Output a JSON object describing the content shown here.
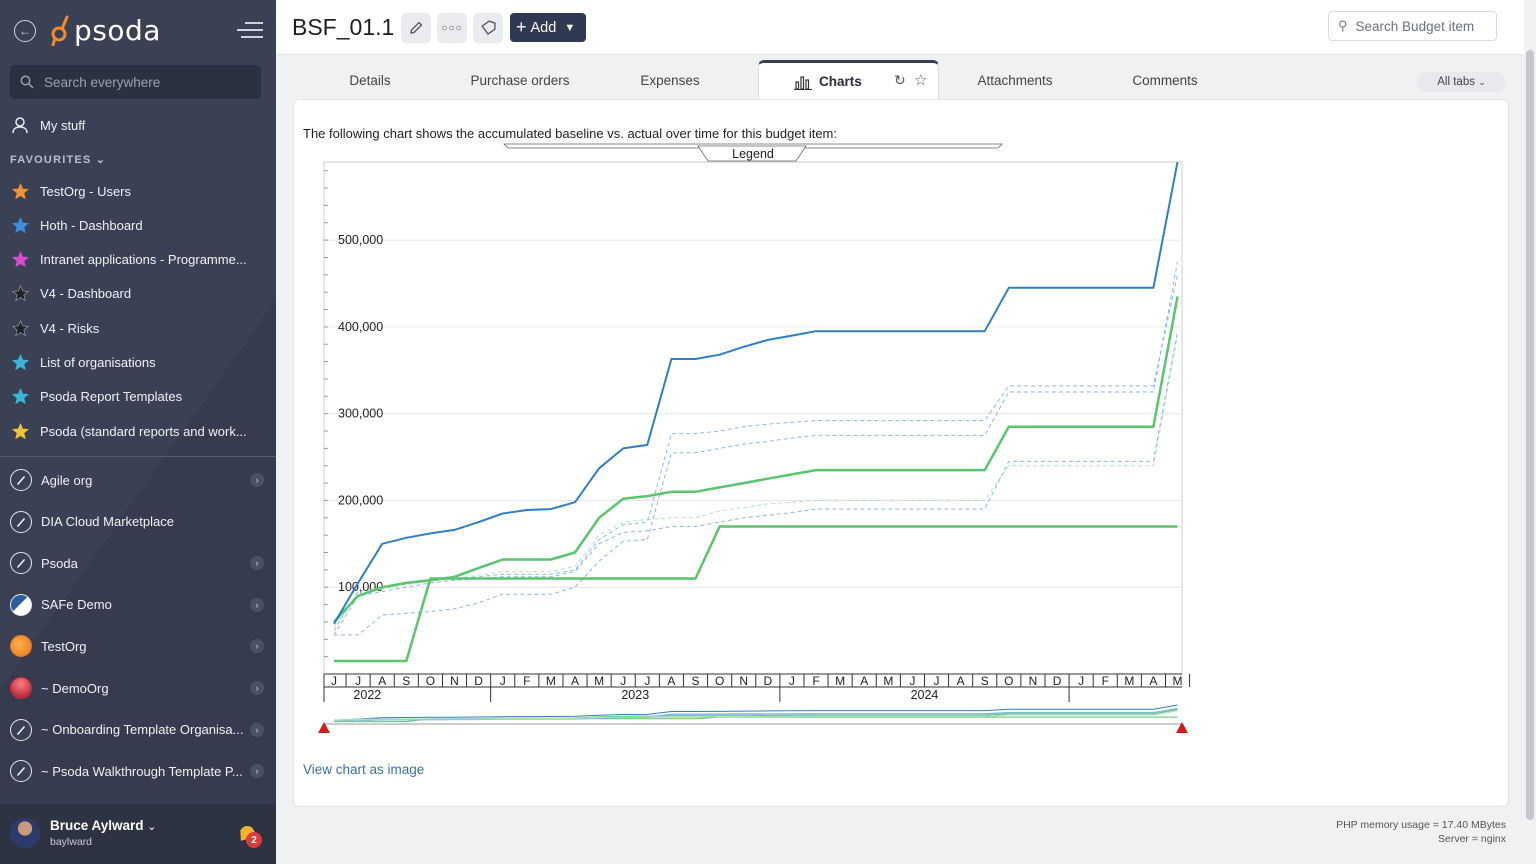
{
  "app": {
    "name": "psoda"
  },
  "sidebar": {
    "search_placeholder": "Search everywhere",
    "my_stuff": "My stuff",
    "favourites_label": "FAVOURITES",
    "favourites": [
      {
        "label": "TestOrg - Users",
        "color": "#f0913a"
      },
      {
        "label": "Hoth - Dashboard",
        "color": "#3b8fe0"
      },
      {
        "label": "Intranet applications - Programme...",
        "color": "#d64ad1"
      },
      {
        "label": "V4 - Dashboard",
        "color": "#222222"
      },
      {
        "label": "V4 - Risks",
        "color": "#222222"
      },
      {
        "label": "List of organisations",
        "color": "#3bb6d6"
      },
      {
        "label": "Psoda Report Templates",
        "color": "#3bb6d6"
      },
      {
        "label": "Psoda (standard reports and work...",
        "color": "#f0c23a"
      }
    ],
    "orgs": [
      {
        "label": "Agile org",
        "chevron": true
      },
      {
        "label": "DIA Cloud Marketplace",
        "chevron": false
      },
      {
        "label": "Psoda",
        "chevron": true
      },
      {
        "label": "SAFe Demo",
        "chevron": true
      },
      {
        "label": "TestOrg",
        "chevron": true
      },
      {
        "label": "~ DemoOrg",
        "chevron": true
      },
      {
        "label": "~ Onboarding Template Organisa...",
        "chevron": true
      },
      {
        "label": "~ Psoda Walkthrough Template P...",
        "chevron": true
      }
    ],
    "user": {
      "name": "Bruce Aylward",
      "login": "baylward",
      "notifications": "2"
    }
  },
  "header": {
    "title": "BSF_01.1",
    "add_label": "Add",
    "search_placeholder": "Search Budget item"
  },
  "tabs": {
    "items": [
      "Details",
      "Purchase orders",
      "Expenses",
      "Charts",
      "Attachments",
      "Comments"
    ],
    "active": "Charts",
    "all_tabs": "All tabs"
  },
  "content": {
    "intro": "The following chart shows the accumulated baseline vs. actual over time for this budget item:",
    "view_image_link": "View chart as image"
  },
  "footer": {
    "memory": "PHP memory usage = 17.40 MBytes",
    "server": "Server = nginx"
  },
  "chart_data": {
    "type": "line",
    "legend_label": "Legend",
    "y_ticks": [
      "100,000",
      "200,000",
      "300,000",
      "400,000",
      "500,000"
    ],
    "ylim": [
      0,
      590000
    ],
    "months": [
      "J",
      "J",
      "A",
      "S",
      "O",
      "N",
      "D",
      "J",
      "F",
      "M",
      "A",
      "M",
      "J",
      "J",
      "A",
      "S",
      "O",
      "N",
      "D",
      "J",
      "F",
      "M",
      "A",
      "M",
      "J",
      "J",
      "A",
      "S",
      "O",
      "N",
      "D",
      "J",
      "F",
      "M",
      "A",
      "M"
    ],
    "years": [
      {
        "label": "2022",
        "start": 0,
        "end": 7
      },
      {
        "label": "2023",
        "start": 7,
        "end": 19
      },
      {
        "label": "2024",
        "start": 19,
        "end": 31
      }
    ],
    "series": [
      {
        "color": "#2f7fc8",
        "width": 2,
        "dash": "",
        "values": [
          58000,
          105000,
          150000,
          157000,
          162000,
          166000,
          175000,
          185000,
          189000,
          190000,
          198000,
          237000,
          260000,
          264000,
          363000,
          363000,
          368000,
          377000,
          385000,
          390000,
          395000,
          395000,
          395000,
          395000,
          395000,
          395000,
          395000,
          395000,
          445000,
          445000,
          445000,
          445000,
          445000,
          445000,
          445000,
          590000
        ]
      },
      {
        "color": "#5ac46e",
        "width": 2.5,
        "dash": "",
        "values": [
          60000,
          90000,
          100000,
          105000,
          108000,
          112000,
          122000,
          132000,
          132000,
          132000,
          140000,
          180000,
          202000,
          205000,
          210000,
          210000,
          215000,
          220000,
          225000,
          230000,
          235000,
          235000,
          235000,
          235000,
          235000,
          235000,
          235000,
          235000,
          285000,
          285000,
          285000,
          285000,
          285000,
          285000,
          285000,
          435000
        ]
      },
      {
        "color": "#5ac46e",
        "width": 2.5,
        "dash": "",
        "values": [
          15000,
          15000,
          15000,
          15000,
          110000,
          110000,
          110000,
          110000,
          110000,
          110000,
          110000,
          110000,
          110000,
          110000,
          110000,
          110000,
          170000,
          170000,
          170000,
          170000,
          170000,
          170000,
          170000,
          170000,
          170000,
          170000,
          170000,
          170000,
          170000,
          170000,
          170000,
          170000,
          170000,
          170000,
          170000,
          170000
        ]
      },
      {
        "color": "#8ab8e6",
        "width": 1,
        "dash": "4,3",
        "values": [
          45000,
          45000,
          68000,
          70000,
          72000,
          75000,
          82000,
          92000,
          92000,
          92000,
          100000,
          130000,
          153000,
          155000,
          255000,
          255000,
          260000,
          265000,
          268000,
          272000,
          275000,
          275000,
          275000,
          275000,
          275000,
          275000,
          275000,
          275000,
          325000,
          325000,
          325000,
          325000,
          325000,
          325000,
          325000,
          475000
        ]
      },
      {
        "color": "#8ab8e6",
        "width": 1,
        "dash": "4,3",
        "values": [
          45000,
          90000,
          95000,
          100000,
          105000,
          108000,
          110000,
          112000,
          112000,
          112000,
          118000,
          150000,
          163000,
          165000,
          170000,
          170000,
          175000,
          180000,
          183000,
          186000,
          190000,
          190000,
          190000,
          190000,
          190000,
          190000,
          190000,
          190000,
          245000,
          245000,
          245000,
          245000,
          245000,
          245000,
          245000,
          395000
        ]
      },
      {
        "color": "#8ab8e6",
        "width": 1,
        "dash": "4,3",
        "values": [
          50000,
          95000,
          100000,
          104000,
          108000,
          110000,
          112000,
          115000,
          115000,
          115000,
          120000,
          155000,
          172000,
          175000,
          277000,
          277000,
          280000,
          285000,
          288000,
          290000,
          292000,
          292000,
          292000,
          292000,
          292000,
          292000,
          292000,
          292000,
          332000,
          332000,
          332000,
          332000,
          332000,
          332000,
          332000,
          460000
        ]
      },
      {
        "color": "#b6e3be",
        "width": 1,
        "dash": "4,3",
        "values": [
          55000,
          92000,
          98000,
          103000,
          107000,
          110000,
          114000,
          118000,
          118000,
          118000,
          124000,
          160000,
          175000,
          178000,
          180000,
          180000,
          188000,
          192000,
          196000,
          198000,
          200000,
          200000,
          200000,
          200000,
          200000,
          200000,
          200000,
          200000,
          240000,
          240000,
          240000,
          240000,
          240000,
          240000,
          240000,
          390000
        ]
      }
    ]
  }
}
